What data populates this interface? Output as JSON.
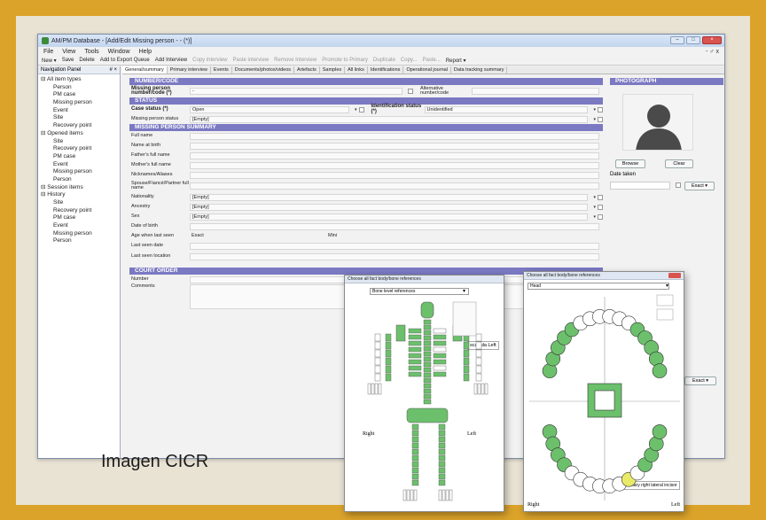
{
  "window": {
    "title": "AM/PM Database - [Add/Edit Missing person - - (*)]",
    "menu": [
      "File",
      "View",
      "Tools",
      "Window",
      "Help"
    ],
    "toolbar": [
      "New ▾",
      "Save",
      "Delete",
      "Add to Export Queue",
      "Add Interview",
      "Copy interview",
      "Paste interview",
      "Remove Interview",
      "Promote to Primary",
      "Duplicate",
      "Copy...",
      "Paste...",
      "Report ▾"
    ],
    "toolbar_disabled": [
      false,
      false,
      false,
      false,
      false,
      true,
      true,
      true,
      true,
      true,
      true,
      true,
      false
    ]
  },
  "nav": {
    "header": "Navigation Panel",
    "pin": "# ×",
    "items": [
      {
        "label": "All item types",
        "level": 0
      },
      {
        "label": "Person",
        "level": 1
      },
      {
        "label": "PM case",
        "level": 1
      },
      {
        "label": "Missing person",
        "level": 1
      },
      {
        "label": "Event",
        "level": 1
      },
      {
        "label": "Site",
        "level": 1
      },
      {
        "label": "Recovery point",
        "level": 1
      },
      {
        "label": "Opened items",
        "level": 0
      },
      {
        "label": "Site",
        "level": 1
      },
      {
        "label": "Recovery point",
        "level": 1
      },
      {
        "label": "PM case",
        "level": 1
      },
      {
        "label": "Event",
        "level": 1
      },
      {
        "label": "Missing person",
        "level": 1
      },
      {
        "label": "Person",
        "level": 1
      },
      {
        "label": "Session items",
        "level": 0
      },
      {
        "label": "History",
        "level": 0
      },
      {
        "label": "Site",
        "level": 1
      },
      {
        "label": "Recovery point",
        "level": 1
      },
      {
        "label": "PM case",
        "level": 1
      },
      {
        "label": "Event",
        "level": 1
      },
      {
        "label": "Missing person",
        "level": 1
      },
      {
        "label": "Person",
        "level": 1
      }
    ]
  },
  "tabs": [
    "General/summary",
    "Primary interview",
    "Events",
    "Documents/photos/videos",
    "Artefacts",
    "Samples",
    "All links",
    "Identifications",
    "Operational journal",
    "Data tracking summary"
  ],
  "sections": {
    "number_code": "NUMBER/CODE",
    "status": "STATUS",
    "summary": "MISSING PERSON SUMMARY",
    "court": "COURT ORDER",
    "photo": "PHOTOGRAPH"
  },
  "number": {
    "mp_label": "Missing person number/code (*)",
    "mp_value": "-",
    "alt_label": "Alternative number/code"
  },
  "status": {
    "case_label": "Case status (*)",
    "case_value": "Open",
    "ident_label": "Identification status (*)",
    "ident_value": "Unidentified",
    "mps_label": "Missing person status",
    "mps_value": "[Empty]"
  },
  "summary": {
    "full_name": "Full name",
    "name_birth": "Name at birth",
    "father": "Father's full name",
    "mother": "Mother's full name",
    "nick": "Nicknames/Aliases",
    "spouse": "Spouse/Fiancé/Partner full name",
    "nationality": "Nationality",
    "nationality_value": "[Empty]",
    "ancestry": "Ancestry",
    "ancestry_value": "[Empty]",
    "sex": "Sex",
    "sex_value": "[Empty]",
    "dob": "Date of birth",
    "age": "Age when last seen",
    "age_exact": "Exact",
    "age_min": "Mini",
    "last_date": "Last seen date",
    "last_loc": "Last seen location"
  },
  "court": {
    "number": "Number",
    "comments": "Comments",
    "exact": "Exact ▾"
  },
  "photo": {
    "browse": "Browse",
    "clear": "Clear",
    "date_taken": "Date taken",
    "exact": "Exact ▾"
  },
  "popup_skeleton": {
    "title": "Choose all fact body/bone references",
    "select": "Bone level references",
    "tooltip": "scapula Left",
    "right": "Right",
    "left": "Left",
    "highlight_color": "#6cc06c"
  },
  "popup_teeth": {
    "title": "Choose all fact body/bone references",
    "select": "Head",
    "tooltip": "maxillary right lateral incisor",
    "right": "Right",
    "left": "Left",
    "highlight_color": "#6cc06c",
    "selected_color": "#eaea6a"
  },
  "caption": "Imagen CICR"
}
